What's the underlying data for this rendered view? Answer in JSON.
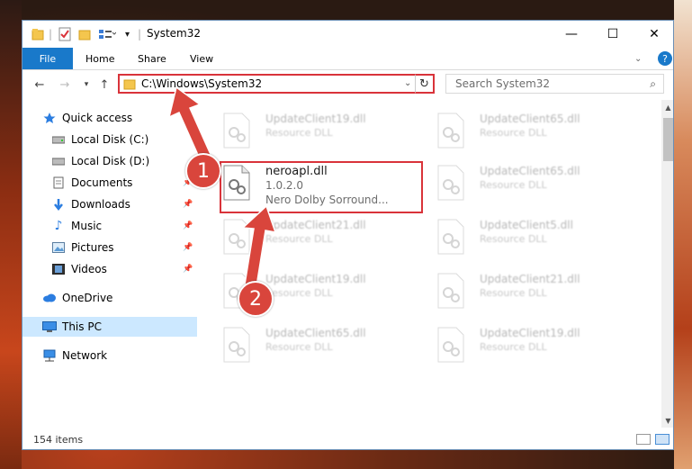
{
  "window": {
    "title": "System32",
    "buttons": {
      "minimize": "—",
      "maximize": "☐",
      "close": "✕"
    }
  },
  "ribbon": {
    "tabs": [
      "File",
      "Home",
      "Share",
      "View"
    ]
  },
  "address": {
    "path": "C:\\Windows\\System32",
    "search_placeholder": "Search System32"
  },
  "sidebar": {
    "items": [
      {
        "label": "Quick access",
        "icon": "star-icon"
      },
      {
        "label": "Local Disk (C:)",
        "icon": "drive-icon"
      },
      {
        "label": "Local Disk (D:)",
        "icon": "drive-icon"
      },
      {
        "label": "Documents",
        "icon": "documents-icon"
      },
      {
        "label": "Downloads",
        "icon": "download-icon"
      },
      {
        "label": "Music",
        "icon": "music-icon"
      },
      {
        "label": "Pictures",
        "icon": "pictures-icon"
      },
      {
        "label": "Videos",
        "icon": "videos-icon"
      },
      {
        "label": "OneDrive",
        "icon": "cloud-icon"
      },
      {
        "label": "This PC",
        "icon": "computer-icon"
      },
      {
        "label": "Network",
        "icon": "network-icon"
      }
    ]
  },
  "files": {
    "focused": {
      "name": "neroapl.dll",
      "version": "1.0.2.0",
      "description": "Nero Dolby Sorround..."
    },
    "blurred": [
      {
        "name": "UpdateClient19.dll",
        "desc": "Resource DLL"
      },
      {
        "name": "UpdateClient65.dll",
        "desc": "Resource DLL"
      },
      {
        "name": "UpdateClient65.dll",
        "desc": "Resource DLL"
      },
      {
        "name": "UpdateClient21.dll",
        "desc": "Resource DLL"
      },
      {
        "name": "UpdateClient5.dll",
        "desc": "Resource DLL"
      },
      {
        "name": "UpdateClient19.dll",
        "desc": "Resource DLL"
      },
      {
        "name": "UpdateClient21.dll",
        "desc": "Resource DLL"
      },
      {
        "name": "UpdateClient65.dll",
        "desc": "Resource DLL"
      },
      {
        "name": "UpdateClient19.dll",
        "desc": "Resource DLL"
      }
    ]
  },
  "status": {
    "item_count": "154 items"
  },
  "annotations": {
    "marker1": "1",
    "marker2": "2",
    "color": "#d9453c"
  }
}
